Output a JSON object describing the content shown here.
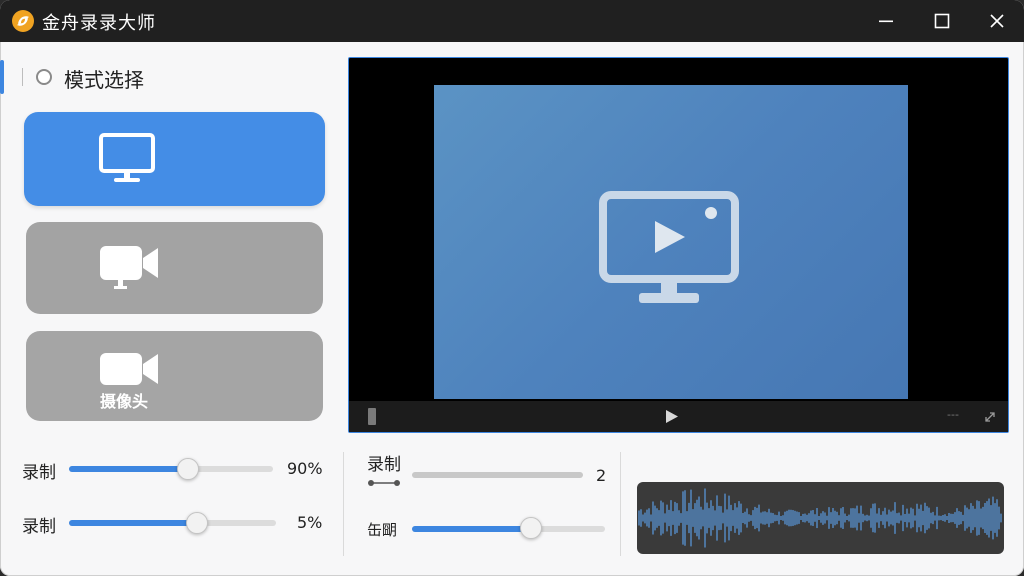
{
  "window": {
    "title": "金舟录录大师",
    "accent_color": "#3d86e0",
    "titlebar_color": "#202020",
    "buttons": {
      "minimize": "minimize-icon",
      "maximize": "maximize-icon",
      "close": "close-icon"
    }
  },
  "sidebar": {
    "section_title": "模式选择",
    "modes": [
      {
        "id": "screen",
        "icon": "monitor-icon",
        "label": "",
        "selected": true
      },
      {
        "id": "camera",
        "icon": "video-camera-icon",
        "label": "",
        "selected": false
      },
      {
        "id": "webcam",
        "icon": "video-camera-icon",
        "label": "摄像头",
        "selected": false
      }
    ]
  },
  "left_sliders": [
    {
      "label": "录制",
      "value_text": "90%",
      "fill_fraction": 0.62
    },
    {
      "label": "录制",
      "value_text": "5%",
      "fill_fraction": 0.62
    }
  ],
  "preview": {
    "icon": "monitor-play-icon",
    "controls": {
      "stop": "stop-icon",
      "play": "play-icon",
      "time": "---",
      "expand": "expand-icon"
    }
  },
  "bottom_controls": {
    "record_label": "录制",
    "record_value": "2",
    "record_fill_fraction": 0.0,
    "second_label": "缶朙",
    "second_fill_fraction": 0.62
  },
  "waveform": {
    "icon": "audio-waveform",
    "color": "#5a9be0"
  }
}
